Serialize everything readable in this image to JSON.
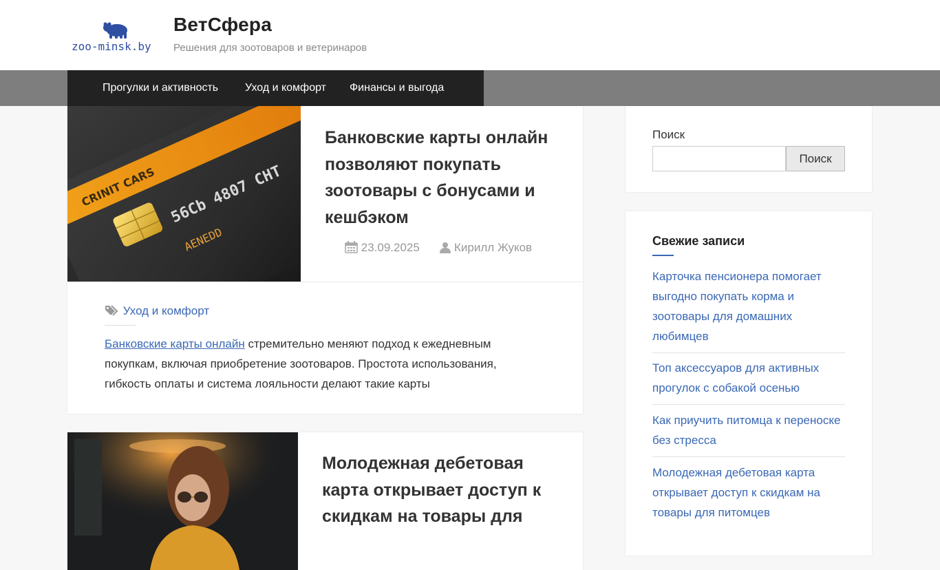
{
  "site": {
    "logo_text": "zoo-minsk.by",
    "title": "ВетСфера",
    "description": "Решения для зоотоваров и ветеринаров"
  },
  "nav": {
    "items": [
      {
        "label": "Прогулки и активность"
      },
      {
        "label": "Уход и комфорт"
      },
      {
        "label": "Финансы и выгода"
      }
    ]
  },
  "posts": [
    {
      "title": "Банковские карты онлайн позволяют покупать зоотовары с бонусами и кешбэком",
      "date": "23.09.2025",
      "author": "Кирилл Жуков",
      "category": "Уход и комфорт",
      "excerpt_link": "Банковские карты онлайн",
      "excerpt_rest": " стремительно меняют подход к ежедневным покупкам, включая приобретение зоотоваров. Простота использования, гибкость оплаты и система лояльности делают такие карты",
      "image_card_text": "CRINIT CARS",
      "image_number": "56Cb 4807 CHT",
      "image_name": "AENEDD"
    },
    {
      "title": "Молодежная дебетовая карта открывает доступ к скидкам на товары для"
    }
  ],
  "sidebar": {
    "search": {
      "label": "Поиск",
      "button_label": "Поиск",
      "value": ""
    },
    "recent": {
      "title": "Свежие записи",
      "items": [
        {
          "label": "Карточка пенсионера помогает выгодно покупать корма и зоотовары для домашних любимцев"
        },
        {
          "label": "Топ аксессуаров для активных прогулок с собакой осенью"
        },
        {
          "label": "Как приучить питомца к переноске без стресса"
        },
        {
          "label": "Молодежная дебетовая карта открывает доступ к скидкам на товары для питомцев"
        }
      ]
    }
  },
  "icons": {
    "calendar": "calendar-icon",
    "user": "user-icon",
    "tags": "tags-icon"
  },
  "colors": {
    "link": "#3a68b5",
    "nav_bg": "#222222",
    "nav_band": "#7e7e7e",
    "page_bg": "#f7f7f7"
  }
}
